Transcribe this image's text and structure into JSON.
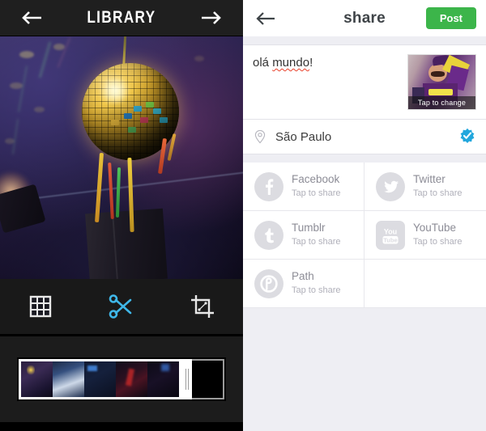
{
  "left_panel": {
    "header": {
      "title": "LIBRARY",
      "back_icon": "arrow-left-icon",
      "forward_icon": "arrow-right-icon"
    },
    "media": {
      "description": "Disco ball with streamers at a night club"
    },
    "tools": [
      {
        "name": "grid-tool",
        "icon": "grid-icon",
        "active": false
      },
      {
        "name": "trim-tool",
        "icon": "scissors-icon",
        "active": true
      },
      {
        "name": "crop-tool",
        "icon": "crop-icon",
        "active": false
      }
    ],
    "timeline": {
      "name": "video-timeline",
      "frame_count": 5,
      "trim_handle": "right-trim-handle"
    },
    "colors": {
      "header_bg": "#1f1f1f",
      "toolbar_bg": "#191919",
      "accent_active": "#3fb7e8"
    }
  },
  "right_panel": {
    "header": {
      "title": "share",
      "back_icon": "arrow-left-icon",
      "post_label": "Post"
    },
    "caption": {
      "text_before": "olá ",
      "misspelled_word": "mundo",
      "text_after": "!",
      "full_text": "olá mundo!"
    },
    "thumbnail": {
      "overlay_label": "Tap to change",
      "description": "Carnival mascot photo"
    },
    "location": {
      "icon": "location-pin-icon",
      "name": "São Paulo",
      "badge_icon": "foursquare-check-gear-icon"
    },
    "social": [
      {
        "name": "Facebook",
        "sub": "Tap to share",
        "icon": "facebook-icon",
        "glyph": "f"
      },
      {
        "name": "Twitter",
        "sub": "Tap to share",
        "icon": "twitter-icon",
        "glyph": "t"
      },
      {
        "name": "Tumblr",
        "sub": "Tap to share",
        "icon": "tumblr-icon",
        "glyph": "t"
      },
      {
        "name": "YouTube",
        "sub": "Tap to share",
        "icon": "youtube-icon",
        "glyph": "You Tube"
      },
      {
        "name": "Path",
        "sub": "Tap to share",
        "icon": "path-icon",
        "glyph": "p"
      }
    ],
    "colors": {
      "page_bg": "#eeeef3",
      "card_bg": "#ffffff",
      "post_green": "#3cb54a",
      "badge_blue": "#22a7dd",
      "icon_grey": "#dcdce1",
      "spellcheck_red": "#e8402a"
    }
  }
}
